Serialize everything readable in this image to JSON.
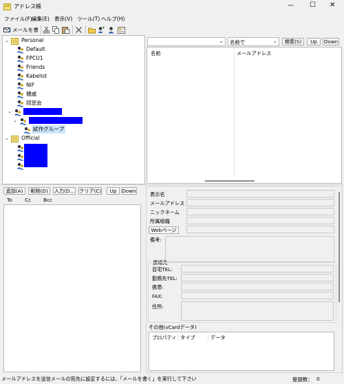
{
  "window": {
    "title": "アドレス帳",
    "controls": [
      "—",
      "☐",
      "✕"
    ]
  },
  "menu": [
    "ファイル(F)",
    "編集(E)",
    "表示(V)",
    "ツール(T)",
    "ヘルプ(H)"
  ],
  "toolbar": {
    "compose_label": "メールを書く"
  },
  "tree": {
    "personal": "Personal",
    "groups": [
      "Default",
      "FPCU1",
      "Friends",
      "Kabelist",
      "NIF",
      "親戚",
      "同窓会"
    ],
    "selected_child": "試作グループ",
    "official": "Official"
  },
  "search": {
    "field_value": "",
    "mode": "名前で",
    "search_button": "検索(S)",
    "up_button": "Up",
    "down_button": "Down",
    "columns": [
      "名前",
      "メールアドレス"
    ]
  },
  "recipients": {
    "buttons": [
      "追加(A)",
      "削除(D)",
      "入力(D...",
      "クリア(C)",
      "Up",
      "Down"
    ],
    "tabs": [
      "To",
      "Cc",
      "Bcc"
    ]
  },
  "details": {
    "labels": [
      "表示名",
      "メールアドレス",
      "ニックネーム",
      "所属組織"
    ],
    "web_button": "Webページ",
    "note_label": "備考:",
    "contact_section": "連絡先",
    "contact_labels": [
      "自宅TEL:",
      "勤務先TEL:",
      "携帯:",
      "FAX:",
      "住所:"
    ],
    "vcard_label": "その他(vCardデータ)",
    "vcard_columns": [
      "プロパティ",
      "タイプ",
      "データ"
    ]
  },
  "status": {
    "message": "メールアドレスを送信メールの宛先に設定するには、「メールを書く」を実行して下さい",
    "count_label": "登録数：",
    "count_value": "0"
  }
}
